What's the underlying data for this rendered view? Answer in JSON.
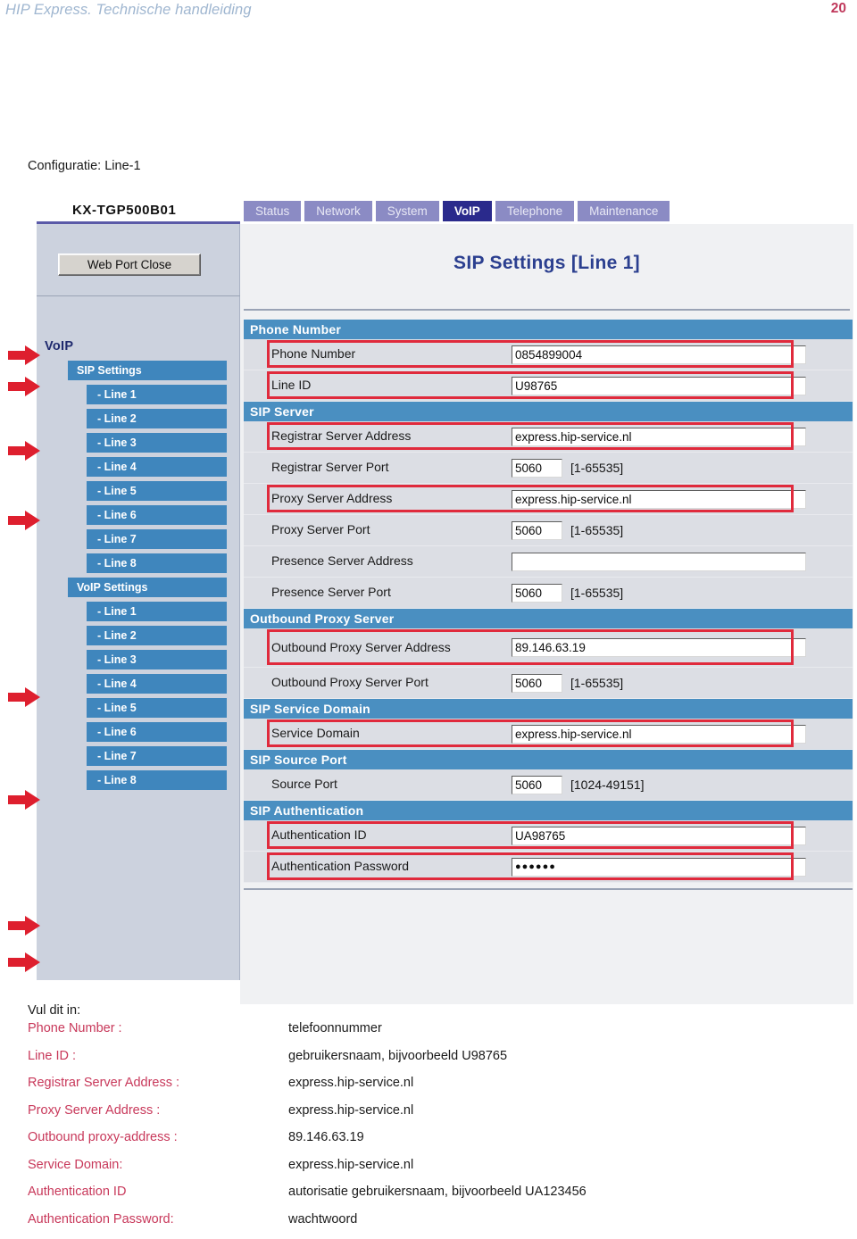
{
  "document_header": {
    "title": "HIP Express. Technische handleiding",
    "page_number": "20"
  },
  "caption": "Configuratie: Line-1",
  "device_ui": {
    "brand": "KX-TGP500B01",
    "tabs": [
      {
        "label": "Status",
        "active": false
      },
      {
        "label": "Network",
        "active": false
      },
      {
        "label": "System",
        "active": false
      },
      {
        "label": "VoIP",
        "active": true
      },
      {
        "label": "Telephone",
        "active": false
      },
      {
        "label": "Maintenance",
        "active": false
      }
    ],
    "sidebar": {
      "web_port_close": "Web Port Close",
      "heading": "VoIP",
      "items": [
        {
          "label": "SIP Settings",
          "type": "group"
        },
        {
          "label": "- Line 1",
          "type": "child"
        },
        {
          "label": "- Line 2",
          "type": "child"
        },
        {
          "label": "- Line 3",
          "type": "child"
        },
        {
          "label": "- Line 4",
          "type": "child"
        },
        {
          "label": "- Line 5",
          "type": "child"
        },
        {
          "label": "- Line 6",
          "type": "child"
        },
        {
          "label": "- Line 7",
          "type": "child"
        },
        {
          "label": "- Line 8",
          "type": "child"
        },
        {
          "label": "VoIP Settings",
          "type": "group"
        },
        {
          "label": "- Line 1",
          "type": "child"
        },
        {
          "label": "- Line 2",
          "type": "child"
        },
        {
          "label": "- Line 3",
          "type": "child"
        },
        {
          "label": "- Line 4",
          "type": "child"
        },
        {
          "label": "- Line 5",
          "type": "child"
        },
        {
          "label": "- Line 6",
          "type": "child"
        },
        {
          "label": "- Line 7",
          "type": "child"
        },
        {
          "label": "- Line 8",
          "type": "child"
        }
      ]
    },
    "page_title": "SIP Settings [Line 1]",
    "sections": [
      {
        "heading": "Phone Number",
        "rows": [
          {
            "label": "Phone Number",
            "value": "0854899004",
            "field": "wide",
            "hint": "",
            "marked": true
          },
          {
            "label": "Line ID",
            "value": "U98765",
            "field": "wide",
            "hint": "",
            "marked": true
          }
        ]
      },
      {
        "heading": "SIP Server",
        "rows": [
          {
            "label": "Registrar Server Address",
            "value": "express.hip-service.nl",
            "field": "wide",
            "hint": "",
            "marked": true
          },
          {
            "label": "Registrar Server Port",
            "value": "5060",
            "field": "narrow",
            "hint": "[1-65535]",
            "marked": false
          },
          {
            "label": "Proxy Server Address",
            "value": "express.hip-service.nl",
            "field": "wide",
            "hint": "",
            "marked": true
          },
          {
            "label": "Proxy Server Port",
            "value": "5060",
            "field": "narrow",
            "hint": "[1-65535]",
            "marked": false
          },
          {
            "label": "Presence Server Address",
            "value": "",
            "field": "wide",
            "hint": "",
            "marked": false
          },
          {
            "label": "Presence Server Port",
            "value": "5060",
            "field": "narrow",
            "hint": "[1-65535]",
            "marked": false
          }
        ]
      },
      {
        "heading": "Outbound Proxy Server",
        "rows": [
          {
            "label": "Outbound Proxy Server Address",
            "value": "89.146.63.19",
            "field": "wide",
            "hint": "",
            "marked": true,
            "tall": true
          },
          {
            "label": "Outbound Proxy Server Port",
            "value": "5060",
            "field": "narrow",
            "hint": "[1-65535]",
            "marked": false
          }
        ]
      },
      {
        "heading": "SIP Service Domain",
        "rows": [
          {
            "label": "Service Domain",
            "value": "express.hip-service.nl",
            "field": "wide",
            "hint": "",
            "marked": true
          }
        ]
      },
      {
        "heading": "SIP Source Port",
        "rows": [
          {
            "label": "Source Port",
            "value": "5060",
            "field": "narrow",
            "hint": "[1024-49151]",
            "marked": false
          }
        ]
      },
      {
        "heading": "SIP Authentication",
        "rows": [
          {
            "label": "Authentication ID",
            "value": "UA98765",
            "field": "wide",
            "hint": "",
            "marked": true
          },
          {
            "label": "Authentication Password",
            "value": "●●●●●●",
            "field": "wide",
            "hint": "",
            "marked": true,
            "masked": true
          }
        ]
      }
    ]
  },
  "arrows": {
    "color": "#de1f2e",
    "positions": [
      398,
      433,
      505,
      583,
      781,
      896,
      1037,
      1078
    ]
  },
  "instructions": {
    "intro": "Vul dit in:",
    "rows": [
      {
        "key": "Phone Number :",
        "value": "telefoonnummer"
      },
      {
        "key": "Line ID  :",
        "value": " gebruikersnaam, bijvoorbeeld U98765"
      },
      {
        "key": "Registrar Server Address :",
        "value": "express.hip-service.nl"
      },
      {
        "key": "Proxy Server Address  :",
        "value": "express.hip-service.nl"
      },
      {
        "key": "Outbound proxy-address :",
        "value": "89.146.63.19"
      },
      {
        "key": "Service Domain:",
        "value": "express.hip-service.nl"
      },
      {
        "key": "Authentication ID",
        "value": "autorisatie gebruikersnaam, bijvoorbeeld UA123456"
      },
      {
        "key": "Authentication Password:",
        "value": "wachtwoord"
      }
    ]
  }
}
